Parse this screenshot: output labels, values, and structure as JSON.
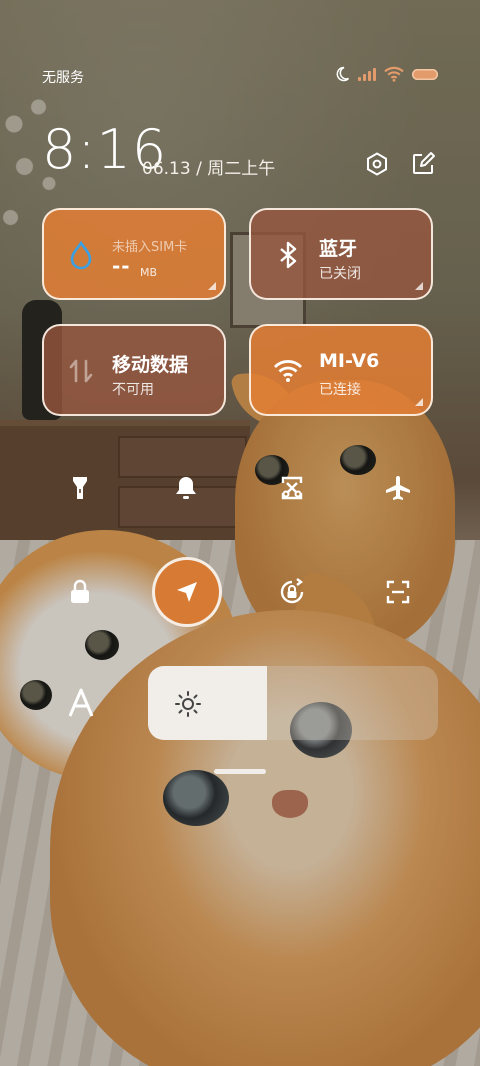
{
  "status_bar": {
    "carrier": "无服务",
    "icons": [
      "moon-icon",
      "signal-icon",
      "wifi-icon",
      "battery-icon"
    ],
    "accent": "#e39b6b"
  },
  "header": {
    "time": "8:16",
    "date": "06.13 / 周二上午",
    "icons": [
      "settings-icon",
      "edit-icon"
    ]
  },
  "tiles": {
    "data": {
      "title": "未插入SIM卡",
      "value": "--",
      "unit": "MB",
      "icon": "water-drop-icon",
      "state": "on"
    },
    "bluetooth": {
      "title": "蓝牙",
      "status": "已关闭",
      "icon": "bluetooth-icon",
      "state": "off"
    },
    "mobile_data": {
      "title": "移动数据",
      "status": "不可用",
      "icon": "mobile-data-icon",
      "state": "off"
    },
    "wifi": {
      "title": "MI-V6",
      "status": "已连接",
      "icon": "wifi-icon",
      "state": "on"
    }
  },
  "toggles_row1": [
    "flashlight-icon",
    "bell-icon",
    "screenshot-icon",
    "airplane-icon"
  ],
  "toggles_row2": [
    "lock-icon",
    "location-icon",
    "rotation-lock-icon",
    "scan-icon"
  ],
  "active_toggle": "location-icon",
  "brightness": {
    "level": 0.41,
    "icon": "sun-icon"
  },
  "font_icon": "font-size-icon",
  "colors": {
    "tile_on": "#e27e34",
    "tile_off": "#96563e",
    "active": "#d67a34"
  }
}
